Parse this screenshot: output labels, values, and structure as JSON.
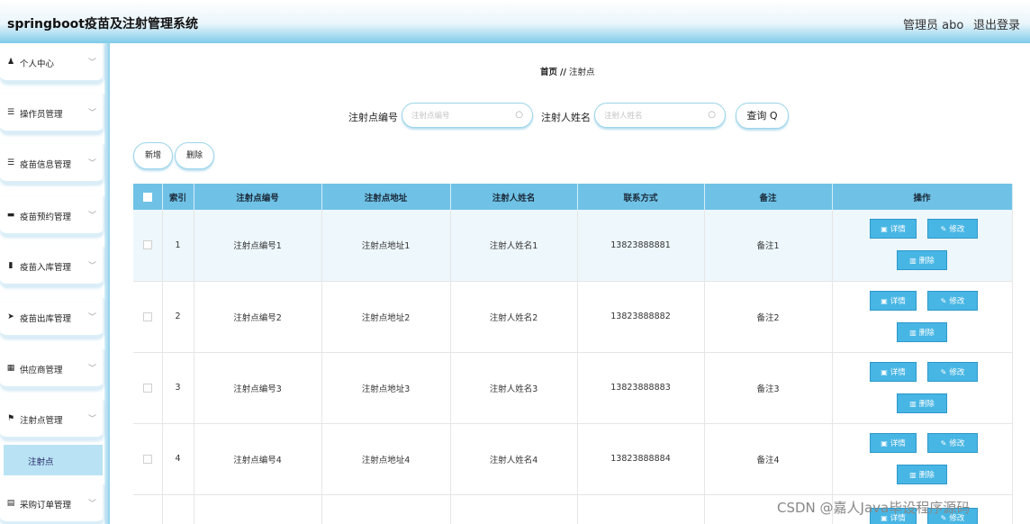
{
  "header": {
    "title": "springboot疫苗及注射管理系统",
    "user": "管理员 abo",
    "logout": "退出登录"
  },
  "sidebar": {
    "items": [
      {
        "label": "个人中心",
        "icon": "person-icon",
        "glyph": "♟"
      },
      {
        "label": "操作员管理",
        "icon": "list-icon",
        "glyph": "☰"
      },
      {
        "label": "疫苗信息管理",
        "icon": "list-icon",
        "glyph": "☰"
      },
      {
        "label": "疫苗预约管理",
        "icon": "folder-icon",
        "glyph": "▬"
      },
      {
        "label": "疫苗入库管理",
        "icon": "book-icon",
        "glyph": "▮"
      },
      {
        "label": "疫苗出库管理",
        "icon": "send-icon",
        "glyph": "➤"
      },
      {
        "label": "供应商管理",
        "icon": "grid-icon",
        "glyph": "▦"
      },
      {
        "label": "注射点管理",
        "icon": "flag-icon",
        "glyph": "⚑"
      },
      {
        "label": "采购订单管理",
        "icon": "document-icon",
        "glyph": "▤"
      }
    ],
    "active_sub": "注射点"
  },
  "breadcrumb": {
    "home": "首页",
    "sep": "//",
    "current": "注射点"
  },
  "search": {
    "field1_label": "注射点编号",
    "field1_placeholder": "注射点编号",
    "field2_label": "注射人姓名",
    "field2_placeholder": "注射人姓名",
    "query": "查询 Q"
  },
  "actions": {
    "add": "新增",
    "delete": "删除"
  },
  "table": {
    "headers": [
      "索引",
      "注射点编号",
      "注射点地址",
      "注射人姓名",
      "联系方式",
      "备注",
      "操作"
    ],
    "rows": [
      {
        "index": "1",
        "code": "注射点编号1",
        "address": "注射点地址1",
        "name": "注射人姓名1",
        "phone": "13823888881",
        "note": "备注1"
      },
      {
        "index": "2",
        "code": "注射点编号2",
        "address": "注射点地址2",
        "name": "注射人姓名2",
        "phone": "13823888882",
        "note": "备注2"
      },
      {
        "index": "3",
        "code": "注射点编号3",
        "address": "注射点地址3",
        "name": "注射人姓名3",
        "phone": "13823888883",
        "note": "备注3"
      },
      {
        "index": "4",
        "code": "注射点编号4",
        "address": "注射点地址4",
        "name": "注射人姓名4",
        "phone": "13823888884",
        "note": "备注4"
      }
    ],
    "ops": {
      "detail": "详情",
      "edit": "修改",
      "delete": "删除"
    }
  },
  "watermark": "CSDN @嘉人Java毕设程序源码",
  "colors": {
    "accent": "#48b6e4",
    "header_bg": "#6fc2e6",
    "active_sub_bg": "#b9e3f4"
  }
}
